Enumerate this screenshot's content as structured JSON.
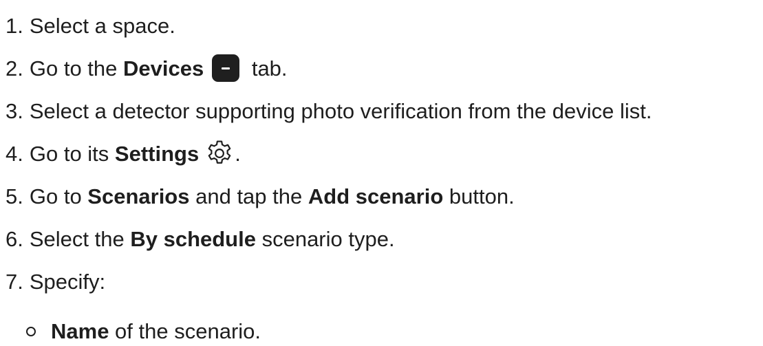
{
  "steps": [
    {
      "num": "1.",
      "text": "Select a space."
    },
    {
      "num": "2.",
      "pre": "Go to the ",
      "bold": "Devices",
      "post": " tab.",
      "icon": "devices-tab-icon"
    },
    {
      "num": "3.",
      "text": "Select a detector supporting photo verification from the device list."
    },
    {
      "num": "4.",
      "pre": "Go to its ",
      "bold": "Settings",
      "post": ".",
      "icon": "gear-icon"
    },
    {
      "num": "5.",
      "pre": "Go to ",
      "bold": "Scenarios",
      "mid": " and tap the ",
      "bold2": "Add scenario",
      "post": " button."
    },
    {
      "num": "6.",
      "pre": "Select the ",
      "bold": "By schedule",
      "post": " scenario type."
    },
    {
      "num": "7.",
      "text": "Specify:"
    }
  ],
  "substeps": [
    {
      "bold": "Name",
      "post": " of the scenario."
    }
  ]
}
